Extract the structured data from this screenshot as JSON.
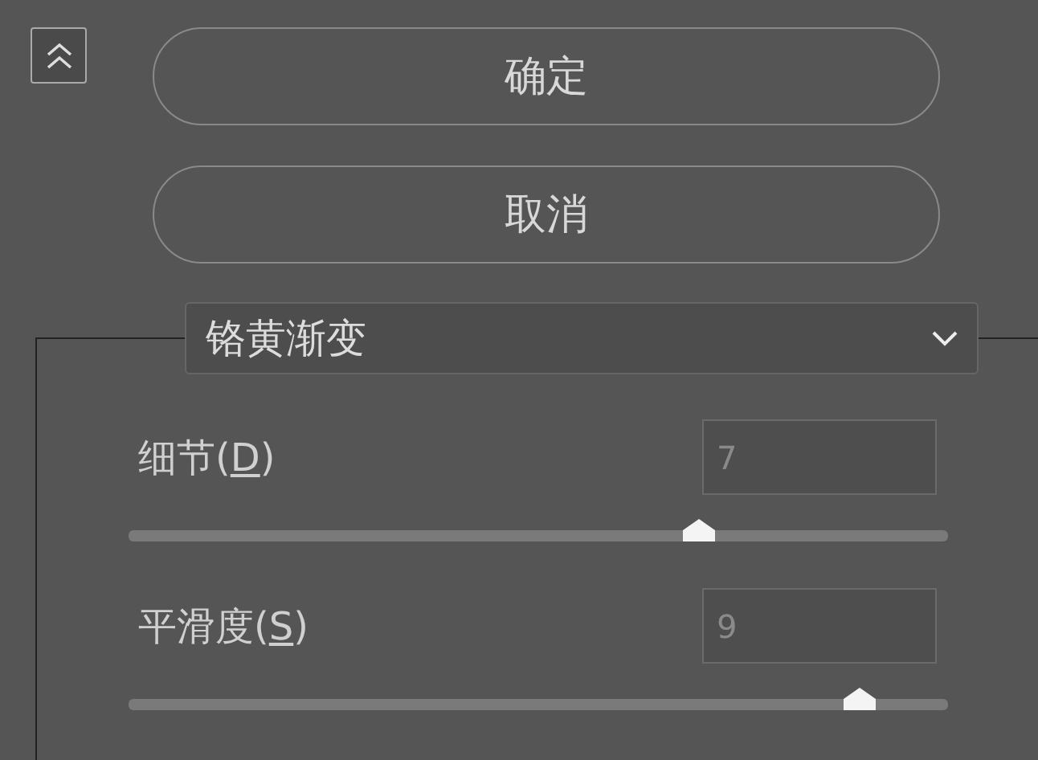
{
  "buttons": [
    {
      "label": "确定"
    },
    {
      "label": "取消"
    }
  ],
  "preset": {
    "value": "铬黄渐变"
  },
  "params": [
    {
      "label": "细节(",
      "accelerator": "D",
      "label_end": ")",
      "value": "7",
      "level": 0.696
    },
    {
      "label": "平滑度(",
      "accelerator": "S",
      "label_end": ")",
      "value": "9",
      "level": 0.892
    }
  ]
}
